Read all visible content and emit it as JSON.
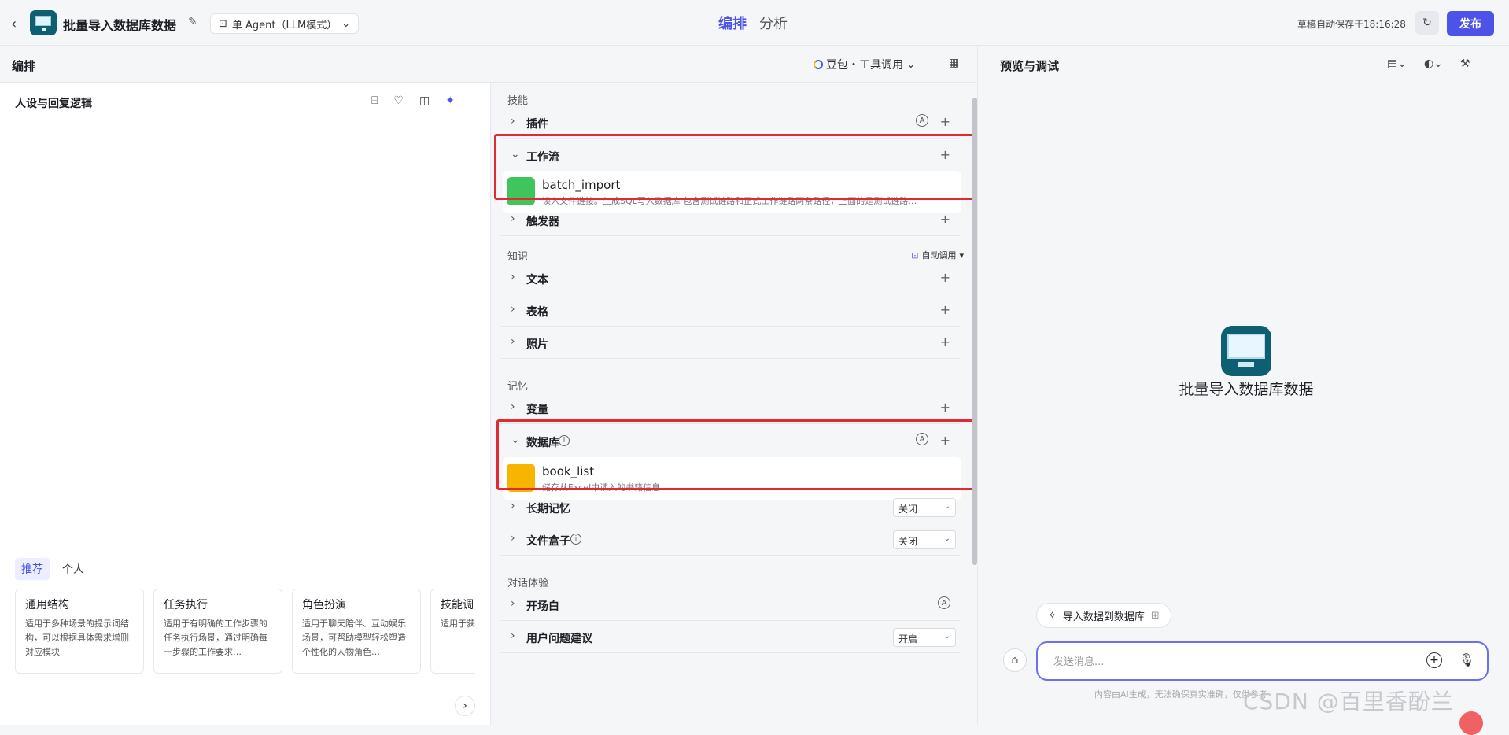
{
  "header": {
    "app_title": "批量导入数据库数据",
    "agent_mode": "单 Agent（LLM模式）",
    "tabs": [
      {
        "label": "编排"
      },
      {
        "label": "分析"
      }
    ],
    "autosave": "草稿自动保存于18:16:28",
    "publish_label": "发布"
  },
  "editor": {
    "title": "编排",
    "model": "豆包・工具调用"
  },
  "persona": {
    "title": "人设与回复逻辑",
    "template_tabs": [
      {
        "label": "推荐"
      },
      {
        "label": "个人"
      }
    ],
    "templates": [
      {
        "title": "通用结构",
        "desc": "适用于多种场景的提示词结构，可以根据具体需求增删对应模块"
      },
      {
        "title": "任务执行",
        "desc": "适用于有明确的工作步骤的任务执行场景，通过明确每一步骤的工作要求…"
      },
      {
        "title": "角色扮演",
        "desc": "适用于聊天陪伴、互动娱乐场景，可帮助模型轻松塑造个性化的人物角色…"
      },
      {
        "title": "技能调",
        "desc": "适用于获取的场景"
      }
    ]
  },
  "skills": {
    "group_skill": "技能",
    "plugin": "插件",
    "workflow": "工作流",
    "workflow_item": {
      "name": "batch_import",
      "desc": "读入文件链接。生成SQL写入数据库 包含测试链路和正式工作链路两条路径，上面的是测试链路…"
    },
    "trigger": "触发器",
    "group_knowledge": "知识",
    "auto_invoke": "自动调用",
    "text": "文本",
    "table": "表格",
    "photo": "照片",
    "group_memory": "记忆",
    "variable": "变量",
    "database": "数据库",
    "database_item": {
      "name": "book_list",
      "desc": "储存从Excel中读入的书籍信息"
    },
    "long_memory": "长期记忆",
    "long_memory_value": "关闭",
    "file_box": "文件盒子",
    "file_box_value": "关闭",
    "group_dialog": "对话体验",
    "opening": "开场白",
    "suggestion": "用户问题建议",
    "suggestion_value": "开启"
  },
  "preview": {
    "title": "预览与调试",
    "bot_name": "批量导入数据库数据",
    "suggestion_chip": "导入数据到数据库",
    "input_placeholder": "发送消息...",
    "disclaimer": "内容由AI生成，无法确保真实准确，仅供参考"
  },
  "watermark": "CSDN @百里香酚兰",
  "colors": {
    "accent": "#4d53e8",
    "highlight_box": "#e02b35",
    "workflow_icon": "#3ec65c",
    "database_icon": "#f7b500"
  }
}
